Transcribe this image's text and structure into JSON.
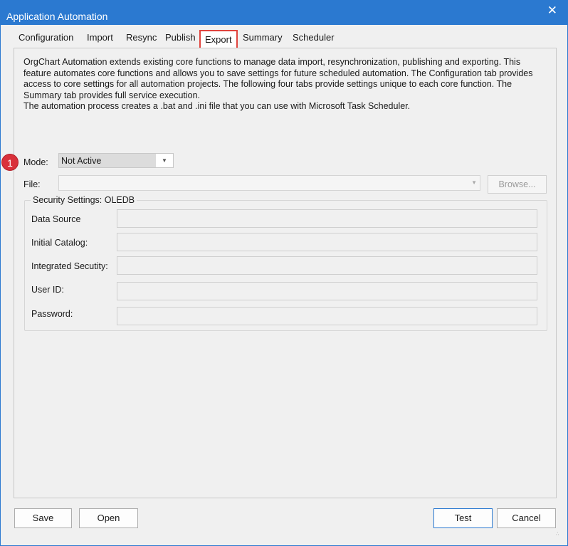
{
  "window": {
    "title": "Application Automation",
    "close_glyph": "✕"
  },
  "tabs": [
    {
      "label": "Configuration"
    },
    {
      "label": "Import"
    },
    {
      "label": "Resync"
    },
    {
      "label": "Publish"
    },
    {
      "label": "Export",
      "active": true,
      "highlight_color": "#e0443e"
    },
    {
      "label": "Summary"
    },
    {
      "label": "Scheduler"
    }
  ],
  "description": {
    "line1": "OrgChart Automation extends existing core functions to manage data import, resynchronization, publishing and exporting. This",
    "line2": "feature automates core functions and allows you to save settings for future scheduled automation. The Configuration tab provides",
    "line3": "access to core settings for all automation projects.  The following four tabs provide settings unique to each core function. The",
    "line4": "Summary tab provides full service execution.",
    "line5": "The automation process creates a .bat and .ini file that you can use with Microsoft Task Scheduler."
  },
  "annotation_badge": {
    "number": "1",
    "color": "#d9303a"
  },
  "mode": {
    "label": "Mode:",
    "value": "Not Active",
    "dropdown_icon": "chevron-down-icon"
  },
  "file": {
    "label": "File:",
    "value": "",
    "browse_label": "Browse..."
  },
  "security": {
    "title": "Security Settings: OLEDB",
    "fields": [
      {
        "label": "Data Source",
        "value": ""
      },
      {
        "label": "Initial Catalog:",
        "value": ""
      },
      {
        "label": "Integrated Secutity:",
        "value": ""
      },
      {
        "label": "User ID:",
        "value": ""
      },
      {
        "label": "Password:",
        "value": ""
      }
    ]
  },
  "buttons": {
    "save": "Save",
    "open": "Open",
    "test": "Test",
    "cancel": "Cancel"
  },
  "colors": {
    "titlebar": "#2b79d0",
    "background": "#f0f0f0"
  }
}
